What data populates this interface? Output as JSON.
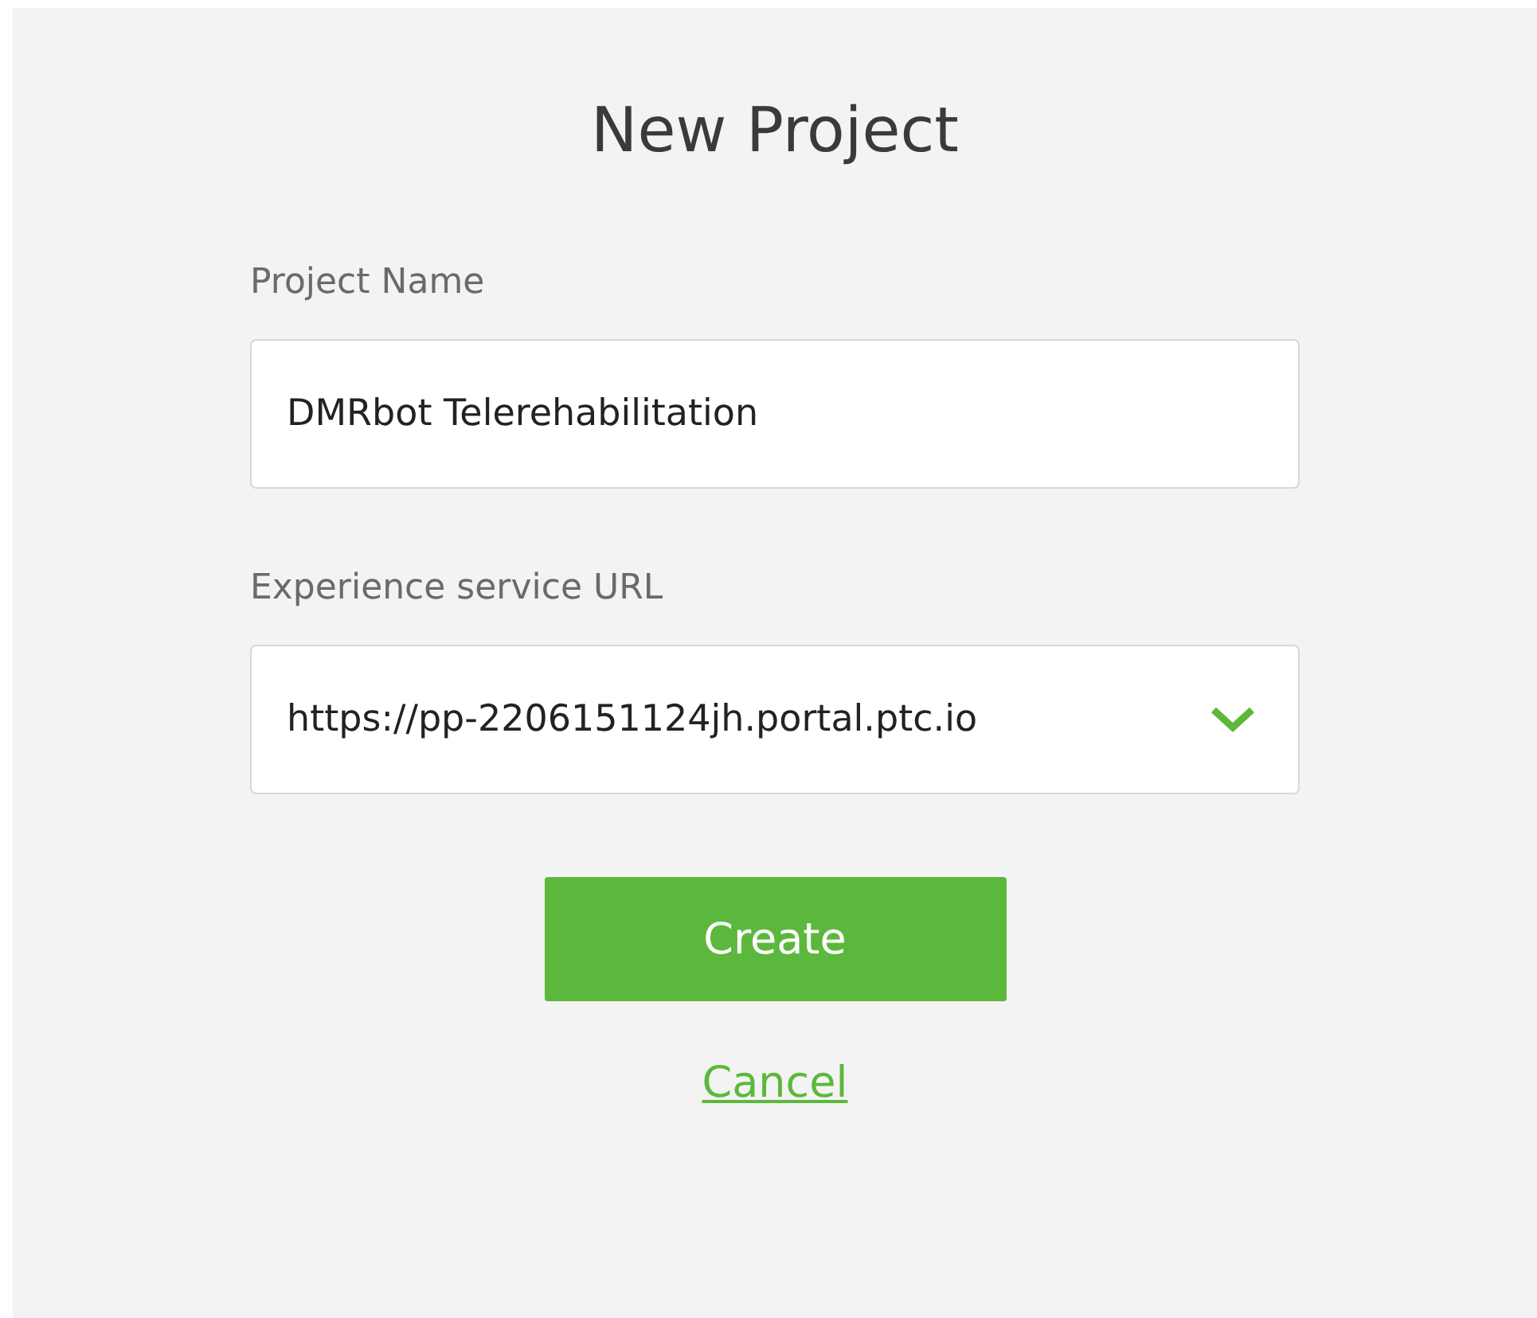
{
  "title": "New Project",
  "fields": [
    {
      "kind": "text",
      "label": "Project Name",
      "value": "DMRbot Telerehabilitation"
    },
    {
      "kind": "select",
      "label": "Experience service URL",
      "value": "https://pp-2206151124jh.portal.ptc.io"
    }
  ],
  "create_button": "Create",
  "cancel_link": "Cancel"
}
